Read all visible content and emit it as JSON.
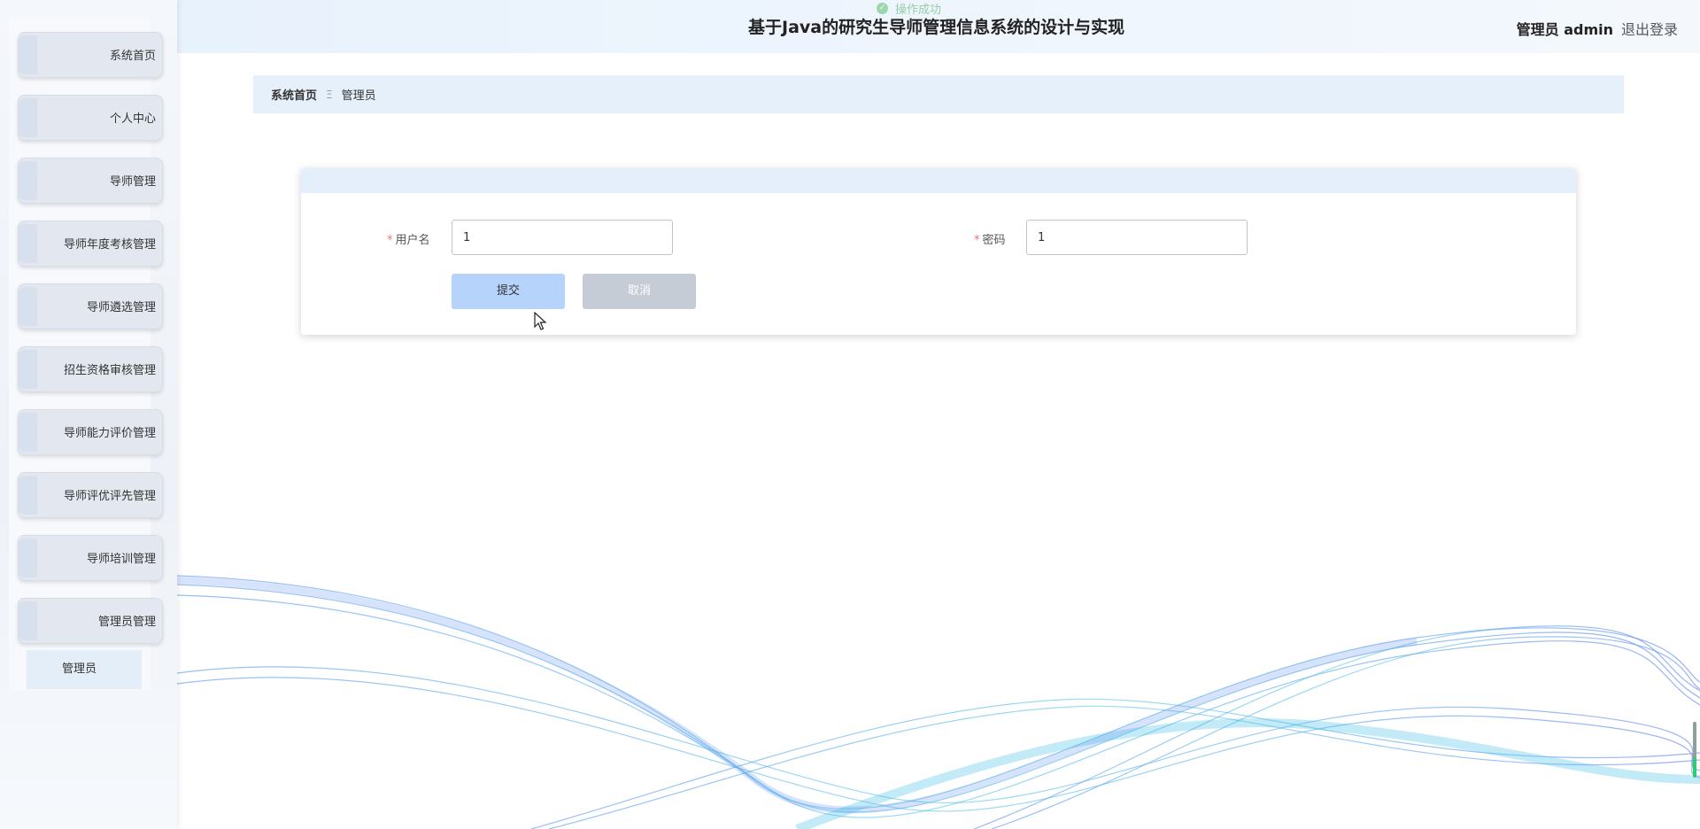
{
  "header": {
    "title": "基于Java的研究生导师管理信息系统的设计与实现",
    "user": "管理员 admin",
    "logout": "退出登录",
    "toast": "操作成功"
  },
  "sidebar": {
    "items": [
      {
        "label": "系统首页"
      },
      {
        "label": "个人中心"
      },
      {
        "label": "导师管理"
      },
      {
        "label": "导师年度考核管理"
      },
      {
        "label": "导师遴选管理"
      },
      {
        "label": "招生资格审核管理"
      },
      {
        "label": "导师能力评价管理"
      },
      {
        "label": "导师评优评先管理"
      },
      {
        "label": "导师培训管理"
      },
      {
        "label": "管理员管理"
      }
    ],
    "submenu": {
      "label": "管理员"
    }
  },
  "breadcrumb": {
    "home": "系统首页",
    "separator": "Ξ",
    "current": "管理员"
  },
  "form": {
    "username": {
      "label": "用户名",
      "required_mark": "*",
      "value": "1"
    },
    "password": {
      "label": "密码",
      "required_mark": "*",
      "value": "1"
    },
    "submit": "提交",
    "cancel": "取消"
  },
  "colors": {
    "accent": "#b6d3fb",
    "header_bg": "#e8f2fc",
    "wave_blue": "#5b8def",
    "wave_cyan": "#3cc6e6"
  }
}
